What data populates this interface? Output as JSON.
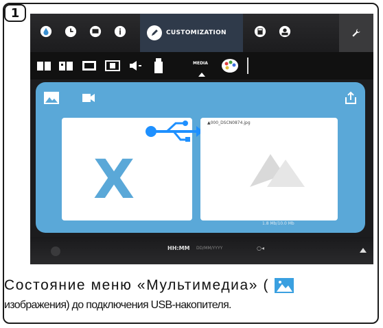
{
  "step": {
    "number": "1"
  },
  "topbar": {
    "icons": [
      "water-drop-icon",
      "clock-icon",
      "chat-icon",
      "info-icon"
    ],
    "active_tab": {
      "label": "CUSTOMIZATION",
      "icon": "pen-icon"
    },
    "right_icons": [
      "calculator-icon",
      "person-icon"
    ],
    "settings_icon": "wrench-icon"
  },
  "subbar": {
    "icons": [
      "book-icon",
      "book-open-icon",
      "picture-frame-icon",
      "screen-icon",
      "speaker-icon",
      "usb-stick-icon",
      "palette-icon"
    ],
    "media_label": "MEDIA"
  },
  "panel": {
    "tabs": [
      "image-icon",
      "video-icon"
    ],
    "export_icon": "export-icon",
    "left_card": {
      "mark": "X",
      "icon": "usb-icon"
    },
    "right_card": {
      "filename": "▲000_DSCN0874.jpg",
      "icon": "mountain-icon"
    },
    "size_info": "1.8 Mb/10.0 Mb"
  },
  "bottombar": {
    "time": "HH:MM",
    "date": "DD/MM/YYYY",
    "network": "○◂"
  },
  "caption": {
    "line1_prefix": "Состояние меню «Мультимедиа» (",
    "line2": "изображения) до подключения USB-накопителя."
  },
  "colors": {
    "accent_blue": "#5aa8d8",
    "screen_bg": "#1c1c1e",
    "active_tab": "#2f3a4a"
  }
}
